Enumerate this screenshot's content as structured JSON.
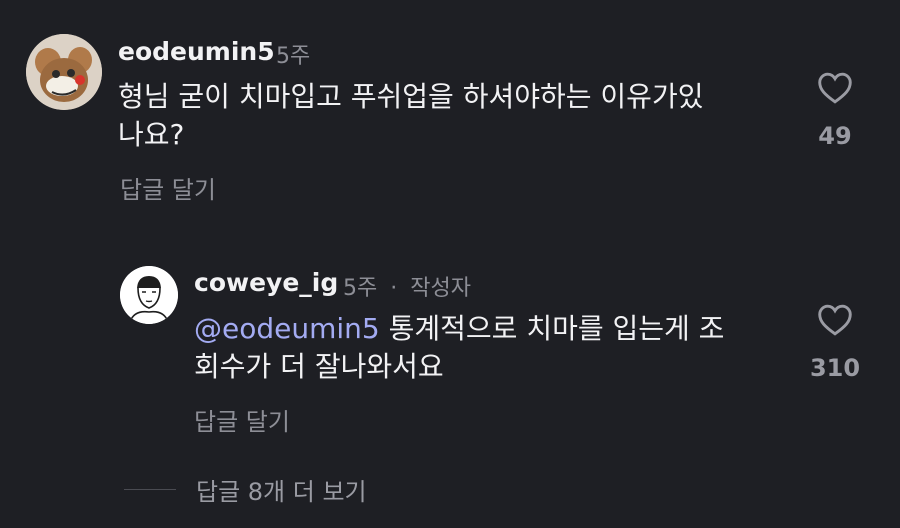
{
  "comment": {
    "username": "eodeumin5",
    "time": "5주",
    "text_line1": "형님 굳이 치마입고 푸쉬업을 하셔야하는 이유가있",
    "text_line2": "나요?",
    "reply_label": "답글 달기",
    "likes": "49",
    "avatar_icon": "cartoon-mouse-avatar"
  },
  "reply": {
    "username": "coweye_ig",
    "time": "5주",
    "separator": "·",
    "author_badge": "작성자",
    "mention": "@eodeumin5",
    "text_line1_rest": " 통계적으로 치마를 입는게 조",
    "text_line2": "회수가 더 잘나와서요",
    "reply_label": "답글 달기",
    "likes": "310",
    "avatar_icon": "line-drawing-face-avatar"
  },
  "view_more_label": "답글 8개 더 보기",
  "colors": {
    "background": "#1e1f24",
    "text": "#f2f2f4",
    "secondary": "#8d8e96",
    "mention": "#a3abf2"
  }
}
